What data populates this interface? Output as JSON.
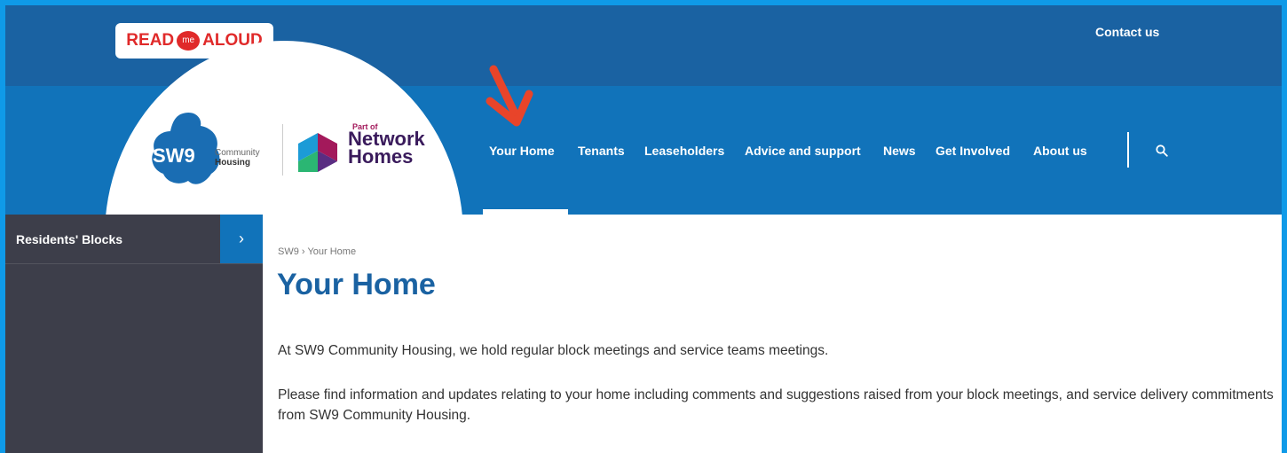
{
  "topbar": {
    "read_aloud": {
      "left": "READ",
      "middle": "me",
      "right": "ALOUD"
    },
    "contact_link": "Contact us"
  },
  "logo": {
    "sw9": "SW9",
    "community": "Community",
    "housing": "Housing",
    "part_of": "Part of",
    "network": "Network",
    "homes": "Homes"
  },
  "nav": {
    "items": [
      {
        "label": "Your Home",
        "active": true
      },
      {
        "label": "Tenants"
      },
      {
        "label": "Leaseholders"
      },
      {
        "label": "Advice and support"
      },
      {
        "label": "News"
      },
      {
        "label": "Get Involved"
      },
      {
        "label": "About us"
      }
    ],
    "search_icon": "search-icon"
  },
  "sidebar": {
    "items": [
      {
        "label": "Residents' Blocks"
      }
    ],
    "chevron": "›"
  },
  "breadcrumb": {
    "root": "SW9",
    "separator": "›",
    "current": "Your Home"
  },
  "main": {
    "title": "Your Home",
    "paragraphs": [
      "At SW9 Community Housing, we hold regular block meetings and service teams meetings.",
      "Please find information and updates relating to your home including comments and suggestions raised from your block meetings, and service delivery commitments from SW9 Community Housing."
    ]
  },
  "colors": {
    "frame": "#0f9ae8",
    "topbar": "#1a62a2",
    "navbar": "#1173ba",
    "sidebar": "#3d3e4a",
    "title": "#1a62a2",
    "annotation_arrow": "#e8442a"
  }
}
